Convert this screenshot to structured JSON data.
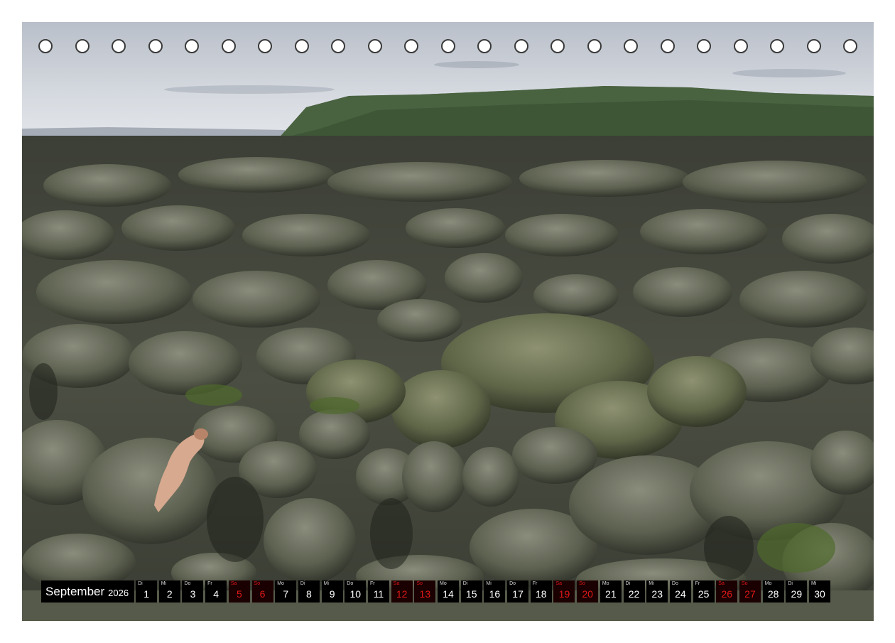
{
  "calendar": {
    "month": "September",
    "year": "2026",
    "colors": {
      "bar_background": "#000000",
      "weekday_text": "#ffffff",
      "weekend_text": "#e01818"
    },
    "days": [
      {
        "wd": "Di",
        "num": "1",
        "weekend": false
      },
      {
        "wd": "Mi",
        "num": "2",
        "weekend": false
      },
      {
        "wd": "Do",
        "num": "3",
        "weekend": false
      },
      {
        "wd": "Fr",
        "num": "4",
        "weekend": false
      },
      {
        "wd": "Sa",
        "num": "5",
        "weekend": true
      },
      {
        "wd": "So",
        "num": "6",
        "weekend": true
      },
      {
        "wd": "Mo",
        "num": "7",
        "weekend": false
      },
      {
        "wd": "Di",
        "num": "8",
        "weekend": false
      },
      {
        "wd": "Mi",
        "num": "9",
        "weekend": false
      },
      {
        "wd": "Do",
        "num": "10",
        "weekend": false
      },
      {
        "wd": "Fr",
        "num": "11",
        "weekend": false
      },
      {
        "wd": "Sa",
        "num": "12",
        "weekend": true
      },
      {
        "wd": "So",
        "num": "13",
        "weekend": true
      },
      {
        "wd": "Mo",
        "num": "14",
        "weekend": false
      },
      {
        "wd": "Di",
        "num": "15",
        "weekend": false
      },
      {
        "wd": "Mi",
        "num": "16",
        "weekend": false
      },
      {
        "wd": "Do",
        "num": "17",
        "weekend": false
      },
      {
        "wd": "Fr",
        "num": "18",
        "weekend": false
      },
      {
        "wd": "Sa",
        "num": "19",
        "weekend": true
      },
      {
        "wd": "So",
        "num": "20",
        "weekend": true
      },
      {
        "wd": "Mo",
        "num": "21",
        "weekend": false
      },
      {
        "wd": "Di",
        "num": "22",
        "weekend": false
      },
      {
        "wd": "Mi",
        "num": "23",
        "weekend": false
      },
      {
        "wd": "Do",
        "num": "24",
        "weekend": false
      },
      {
        "wd": "Fr",
        "num": "25",
        "weekend": false
      },
      {
        "wd": "Sa",
        "num": "26",
        "weekend": true
      },
      {
        "wd": "So",
        "num": "27",
        "weekend": true
      },
      {
        "wd": "Mo",
        "num": "28",
        "weekend": false
      },
      {
        "wd": "Di",
        "num": "29",
        "weekend": false
      },
      {
        "wd": "Mi",
        "num": "30",
        "weekend": false
      }
    ]
  },
  "binding": {
    "ring_count": 23,
    "ring_color": "#3a3a3a"
  },
  "photo": {
    "subject": "moss-covered-lava-field",
    "colors": {
      "sky": "#c9ced6",
      "mountain": "#3e5636",
      "moss": "#5d6150",
      "shadow": "#1f221c"
    }
  }
}
